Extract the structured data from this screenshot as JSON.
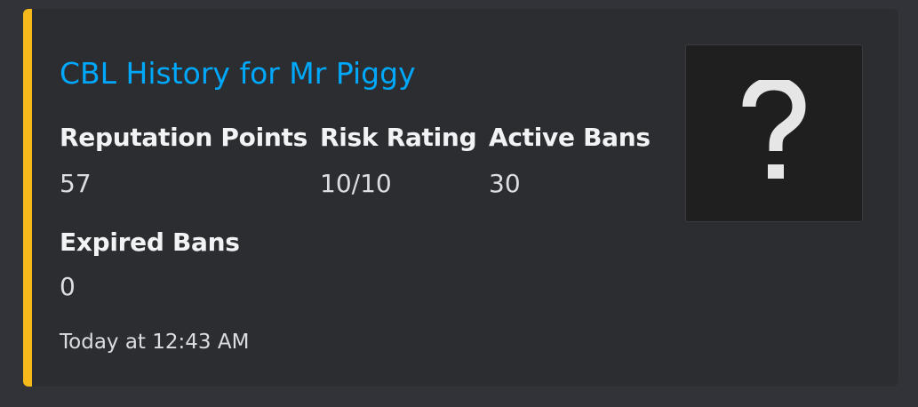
{
  "embed": {
    "accent_color": "#f5b91b",
    "title": "CBL History for Mr Piggy",
    "title_color": "#00a8fc",
    "fields": [
      {
        "name": "Reputation Points",
        "value": "57"
      },
      {
        "name": "Risk Rating",
        "value": "10/10"
      },
      {
        "name": "Active Bans",
        "value": "30"
      },
      {
        "name": "Expired Bans",
        "value": "0"
      }
    ],
    "footer": "Today at 12:43 AM",
    "thumbnail": {
      "icon": "question-mark-icon"
    }
  }
}
